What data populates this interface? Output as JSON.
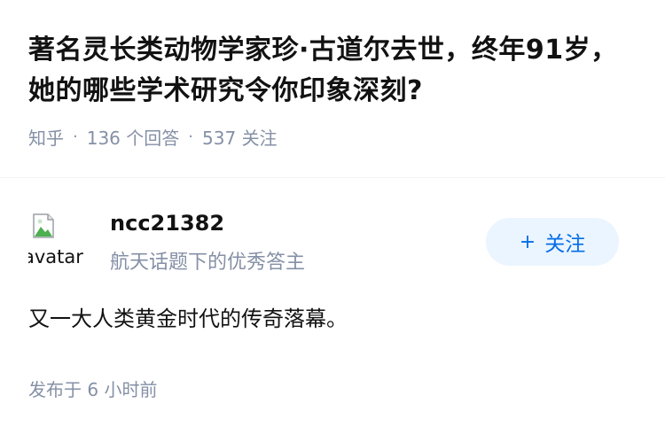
{
  "question": {
    "title": "著名灵长类动物学家珍·古道尔去世，终年91岁，她的哪些学术研究令你印象深刻?",
    "source": "知乎",
    "separator": "·",
    "answers_count": "136",
    "answers_label": "个回答",
    "followers_count": "537",
    "followers_label": "关注"
  },
  "author": {
    "avatar_alt": "avatar",
    "name": "ncc21382",
    "headline": "航天话题下的优秀答主",
    "follow_button": {
      "icon": "+",
      "label": "关注"
    }
  },
  "answer": {
    "text": "又一大人类黄金时代的传奇落幕。",
    "published": "发布于 6 小时前"
  },
  "colors": {
    "text": "#121212",
    "muted": "#8590a6",
    "accent": "#056de8",
    "follow_bg": "#ebf5ff"
  }
}
